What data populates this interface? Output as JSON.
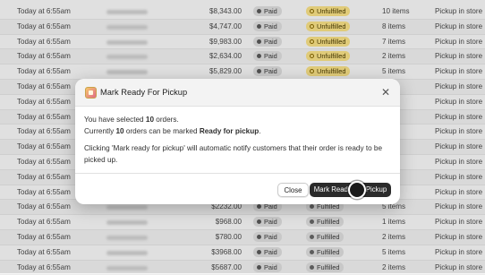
{
  "orders": [
    {
      "date": "Today at 6:55am",
      "total": "$8,343.00",
      "payment": "Paid",
      "fulfillment": "Unfulfilled",
      "items": "10 items",
      "delivery": "Pickup in store"
    },
    {
      "date": "Today at 6:55am",
      "total": "$4,747.00",
      "payment": "Paid",
      "fulfillment": "Unfulfilled",
      "items": "8 items",
      "delivery": "Pickup in store"
    },
    {
      "date": "Today at 6:55am",
      "total": "$9,983.00",
      "payment": "Paid",
      "fulfillment": "Unfulfilled",
      "items": "7 items",
      "delivery": "Pickup in store"
    },
    {
      "date": "Today at 6:55am",
      "total": "$2,634.00",
      "payment": "Paid",
      "fulfillment": "Unfulfilled",
      "items": "2 items",
      "delivery": "Pickup in store"
    },
    {
      "date": "Today at 6:55am",
      "total": "$5,829.00",
      "payment": "Paid",
      "fulfillment": "Unfulfilled",
      "items": "5 items",
      "delivery": "Pickup in store"
    },
    {
      "date": "Today at 6:55am",
      "total": "",
      "payment": "",
      "fulfillment": "",
      "items": "",
      "delivery": "Pickup in store"
    },
    {
      "date": "Today at 6:55am",
      "total": "",
      "payment": "",
      "fulfillment": "",
      "items": "",
      "delivery": "Pickup in store"
    },
    {
      "date": "Today at 6:55am",
      "total": "",
      "payment": "",
      "fulfillment": "",
      "items": "",
      "delivery": "Pickup in store"
    },
    {
      "date": "Today at 6:55am",
      "total": "",
      "payment": "",
      "fulfillment": "",
      "items": "",
      "delivery": "Pickup in store"
    },
    {
      "date": "Today at 6:55am",
      "total": "",
      "payment": "",
      "fulfillment": "",
      "items": "",
      "delivery": "Pickup in store"
    },
    {
      "date": "Today at 6:55am",
      "total": "",
      "payment": "",
      "fulfillment": "",
      "items": "",
      "delivery": "Pickup in store"
    },
    {
      "date": "Today at 6:55am",
      "total": "",
      "payment": "",
      "fulfillment": "",
      "items": "",
      "delivery": "Pickup in store"
    },
    {
      "date": "Today at 6:55am",
      "total": "",
      "payment": "",
      "fulfillment": "",
      "items": "",
      "delivery": "Pickup in store"
    },
    {
      "date": "Today at 6:55am",
      "total": "$2232.00",
      "payment": "Paid",
      "fulfillment": "Fulfilled",
      "items": "5 items",
      "delivery": "Pickup in store"
    },
    {
      "date": "Today at 6:55am",
      "total": "$968.00",
      "payment": "Paid",
      "fulfillment": "Fulfilled",
      "items": "1 items",
      "delivery": "Pickup in store"
    },
    {
      "date": "Today at 6:55am",
      "total": "$780.00",
      "payment": "Paid",
      "fulfillment": "Fulfilled",
      "items": "2 items",
      "delivery": "Pickup in store"
    },
    {
      "date": "Today at 6:55am",
      "total": "$3968.00",
      "payment": "Paid",
      "fulfillment": "Fulfilled",
      "items": "5 items",
      "delivery": "Pickup in store"
    },
    {
      "date": "Today at 6:55am",
      "total": "$5687.00",
      "payment": "Paid",
      "fulfillment": "Fulfilled",
      "items": "2 items",
      "delivery": "Pickup in store"
    }
  ],
  "modal": {
    "title": "Mark Ready For Pickup",
    "icon": "app-icon",
    "line1_prefix": "You have selected ",
    "line1_count": "10",
    "line1_suffix": " orders.",
    "line2_prefix": "Currently ",
    "line2_count": "10",
    "line2_middle": " orders can be marked ",
    "line2_bold": "Ready for pickup",
    "line2_suffix": ".",
    "notice": "Clicking 'Mark ready for pickup' will automatic notify customers that their order is ready to be picked up.",
    "close_label": "Close",
    "primary_label": "Mark Ready For Pickup"
  },
  "colors": {
    "unfulfilled_badge": "#ffe78a",
    "paid_badge": "#e4e4e4",
    "primary_button": "#2b2b2b"
  }
}
